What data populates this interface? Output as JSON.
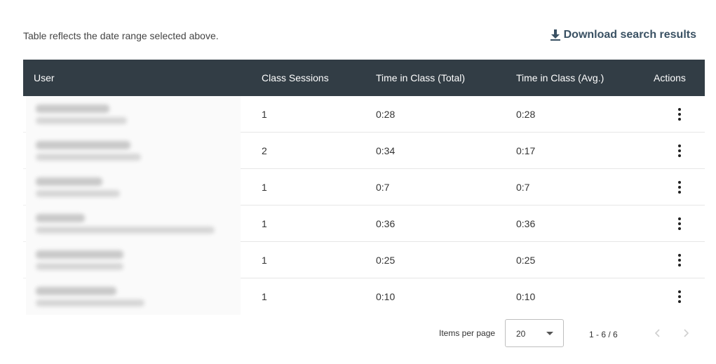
{
  "header": {
    "note": "Table reflects the date range selected above.",
    "download_label": "Download search results"
  },
  "table": {
    "columns": [
      "User",
      "Class Sessions",
      "Time in Class (Total)",
      "Time in Class (Avg.)",
      "Actions"
    ],
    "rows": [
      {
        "sessions": "1",
        "total": "0:28",
        "avg": "0:28"
      },
      {
        "sessions": "2",
        "total": "0:34",
        "avg": "0:17"
      },
      {
        "sessions": "1",
        "total": "0:7",
        "avg": "0:7"
      },
      {
        "sessions": "1",
        "total": "0:36",
        "avg": "0:36"
      },
      {
        "sessions": "1",
        "total": "0:25",
        "avg": "0:25"
      },
      {
        "sessions": "1",
        "total": "0:10",
        "avg": "0:10"
      }
    ]
  },
  "pagination": {
    "items_per_page_label": "Items per page",
    "items_per_page_value": "20",
    "range": "1 - 6 / 6"
  },
  "icons": {
    "download": "download-icon",
    "actions": "more-vertical-icon",
    "prev": "chevron-left-icon",
    "next": "chevron-right-icon",
    "dropdown": "caret-down-icon"
  },
  "colors": {
    "header_bg": "#323d45",
    "link": "#3a5163"
  }
}
